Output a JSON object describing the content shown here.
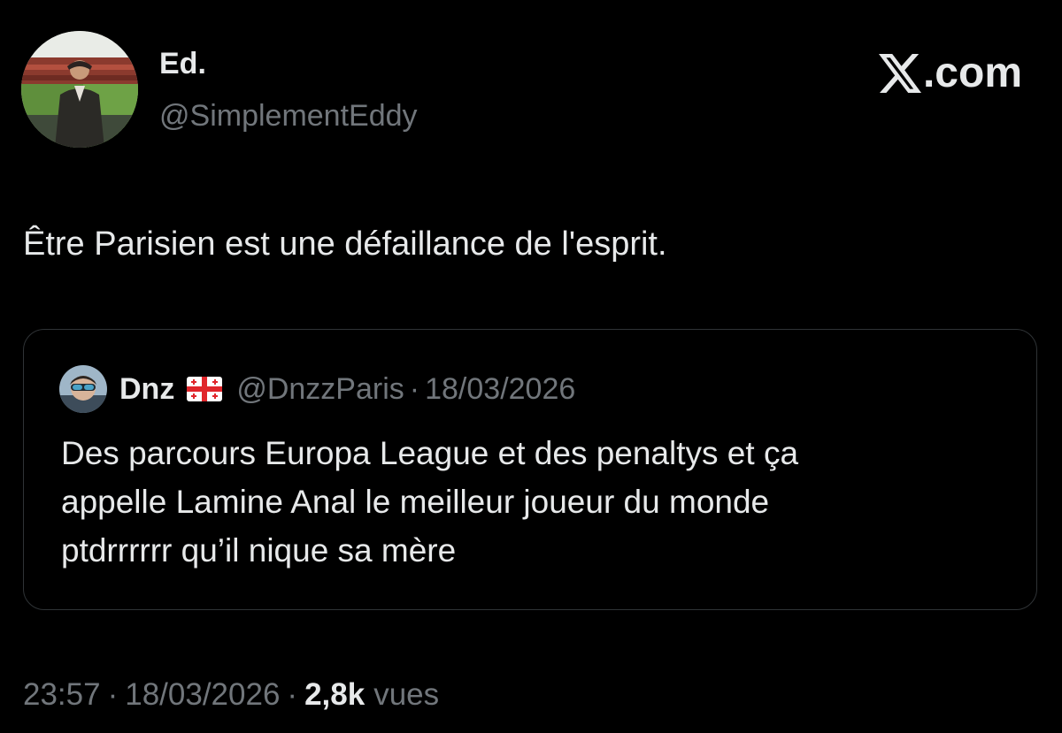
{
  "tweet": {
    "author": {
      "name": "Ed.",
      "handle": "@SimplementEddy"
    },
    "brand": {
      "text": ".com",
      "icon": "x-logo-icon"
    },
    "text": "Être Parisien est une défaillance de l'esprit.",
    "quoted": {
      "name": "Dnz",
      "flag_icon": "georgia-flag-icon",
      "handle": "@DnzzParis",
      "separator": "·",
      "date": "18/03/2026",
      "text_lines": [
        "Des parcours Europa League et des penaltys et ça",
        "appelle Lamine Anal le meilleur joueur du monde",
        "ptdrrrrrr qu’il nique sa mère"
      ]
    },
    "meta": {
      "time": "23:57",
      "separator": "·",
      "date": "18/03/2026",
      "views_count": "2,8k",
      "views_label": "vues"
    }
  },
  "colors": {
    "background": "#000000",
    "primary_text": "#e7e9ea",
    "secondary_text": "#71767b",
    "border": "#2f3336"
  }
}
